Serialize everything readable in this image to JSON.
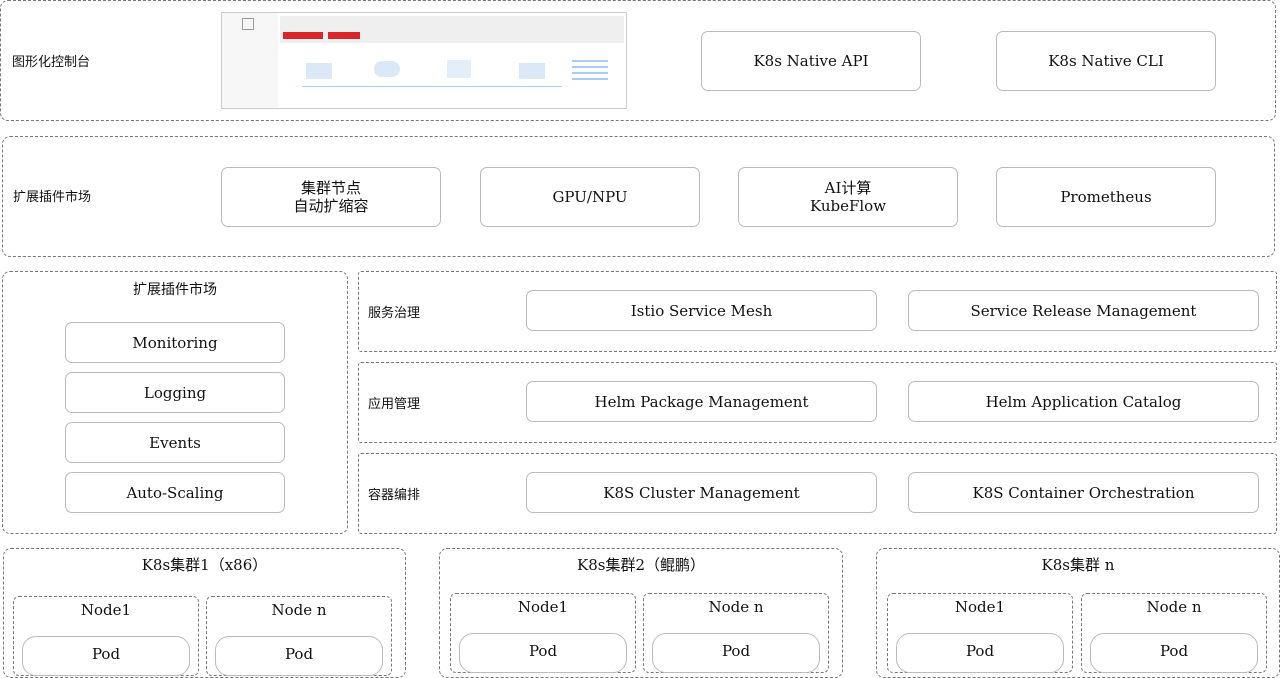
{
  "row1": {
    "label": "图形化控制台",
    "boxes": [
      "K8s Native API",
      "K8s Native CLI"
    ]
  },
  "row2": {
    "label": "扩展插件市场",
    "boxes": [
      "集群节点\n自动扩缩容",
      "GPU/NPU",
      "AI计算\nKubeFlow",
      "Prometheus"
    ]
  },
  "left": {
    "title": "扩展插件市场",
    "items": [
      "Monitoring",
      "Logging",
      "Events",
      "Auto-Scaling"
    ]
  },
  "layers": [
    {
      "label": "服务治理",
      "boxes": [
        "Istio Service Mesh",
        "Service Release Management"
      ]
    },
    {
      "label": "应用管理",
      "boxes": [
        "Helm Package Management",
        "Helm Application Catalog"
      ]
    },
    {
      "label": "容器编排",
      "boxes": [
        "K8S Cluster Management",
        "K8S Container Orchestration"
      ]
    }
  ],
  "clusters": [
    {
      "title": "K8s集群1（x86）",
      "nodes": [
        "Node1",
        "Node n"
      ],
      "pod": "Pod"
    },
    {
      "title": "K8s集群2（鲲鹏）",
      "nodes": [
        "Node1",
        "Node n"
      ],
      "pod": "Pod"
    },
    {
      "title": "K8s集群 n",
      "nodes": [
        "Node1",
        "Node n"
      ],
      "pod": "Pod"
    }
  ]
}
